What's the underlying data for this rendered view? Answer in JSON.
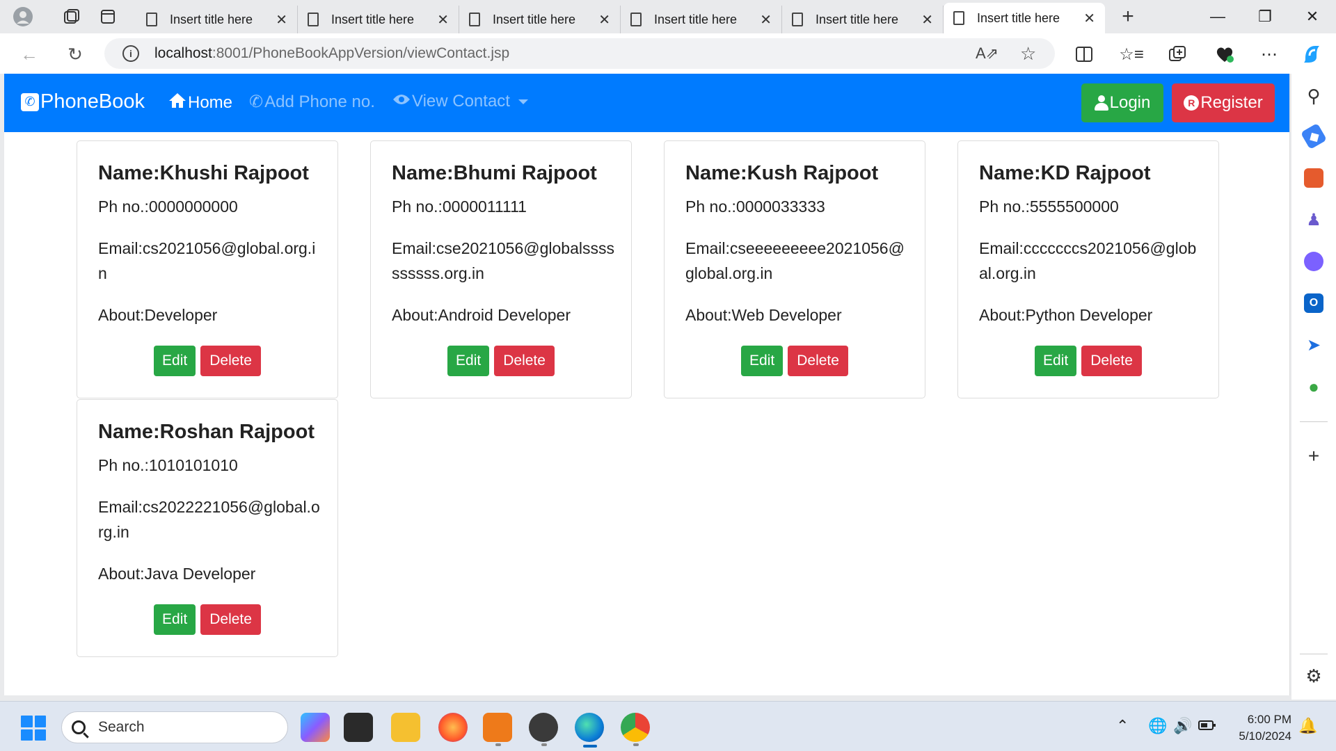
{
  "browser": {
    "tabs": [
      {
        "title": "Insert title here",
        "active": false
      },
      {
        "title": "Insert title here",
        "active": false
      },
      {
        "title": "Insert title here",
        "active": false
      },
      {
        "title": "Insert title here",
        "active": false
      },
      {
        "title": "Insert title here",
        "active": false
      },
      {
        "title": "Insert title here",
        "active": true
      }
    ],
    "url_host": "localhost",
    "url_path": ":8001/PhoneBookAppVersion/viewContact.jsp"
  },
  "navbar": {
    "brand": "PhoneBook",
    "home": "Home",
    "add_phone": "Add Phone no.",
    "view_contact": "View Contact",
    "login": "Login",
    "register": "Register",
    "register_badge": "R"
  },
  "contacts": [
    {
      "name": "Name:Khushi Rajpoot",
      "phone": "Ph no.:0000000000",
      "email": "Email:cs2021056@global.org.in",
      "about": "About:Developer",
      "edit_label": "Edit",
      "delete_label": "Delete"
    },
    {
      "name": "Name:Bhumi Rajpoot",
      "phone": "Ph no.:0000011111",
      "email": "Email:cse2021056@globalssssssssss.org.in",
      "about": "About:Android Developer",
      "edit_label": "Edit",
      "delete_label": "Delete"
    },
    {
      "name": "Name:Kush Rajpoot",
      "phone": "Ph no.:0000033333",
      "email": "Email:cseeeeeeeee2021056@global.org.in",
      "about": "About:Web Developer",
      "edit_label": "Edit",
      "delete_label": "Delete"
    },
    {
      "name": "Name:KD Rajpoot",
      "phone": "Ph no.:5555500000",
      "email": "Email:cccccccs2021056@global.org.in",
      "about": "About:Python Developer",
      "edit_label": "Edit",
      "delete_label": "Delete"
    },
    {
      "name": "Name:Roshan Rajpoot",
      "phone": "Ph no.:1010101010",
      "email": "Email:cs2022221056@global.org.in",
      "about": "About:Java Developer",
      "edit_label": "Edit",
      "delete_label": "Delete"
    }
  ],
  "taskbar": {
    "search_placeholder": "Search",
    "time": "6:00 PM",
    "date": "5/10/2024"
  },
  "colors": {
    "navbar": "#007bff",
    "success": "#28a745",
    "danger": "#dc3545"
  }
}
